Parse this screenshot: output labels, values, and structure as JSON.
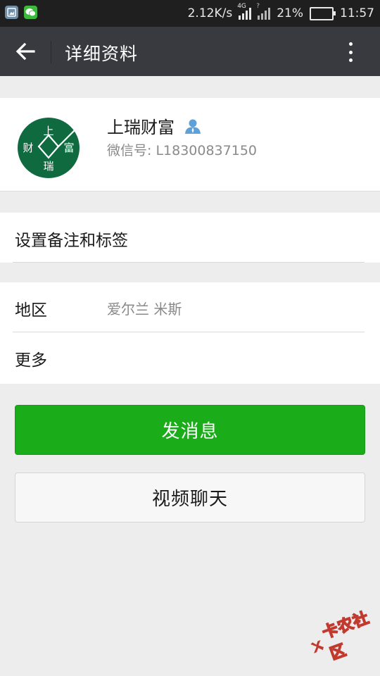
{
  "status_bar": {
    "net_speed": "2.12K/s",
    "network_tag": "4G",
    "signal2_tag": "?",
    "battery_text": "21%",
    "battery_level": 0.21,
    "time": "11:57"
  },
  "titlebar": {
    "title": "详细资料"
  },
  "profile": {
    "avatar_chars": [
      "上",
      "财",
      "富",
      "瑞"
    ],
    "name": "上瑞财富",
    "wechat_id": "微信号: L18300837150"
  },
  "remark": {
    "label": "设置备注和标签"
  },
  "info": {
    "region_label": "地区",
    "region_value": "爱尔兰  米斯",
    "more_label": "更多"
  },
  "actions": {
    "send_message": "发消息",
    "video_chat": "视频聊天"
  },
  "watermark": {
    "text": "卡农社区"
  },
  "colors": {
    "titlebar": "#393a3f",
    "primary_button": "#1aad19",
    "avatar_green": "#0f6b3f"
  }
}
